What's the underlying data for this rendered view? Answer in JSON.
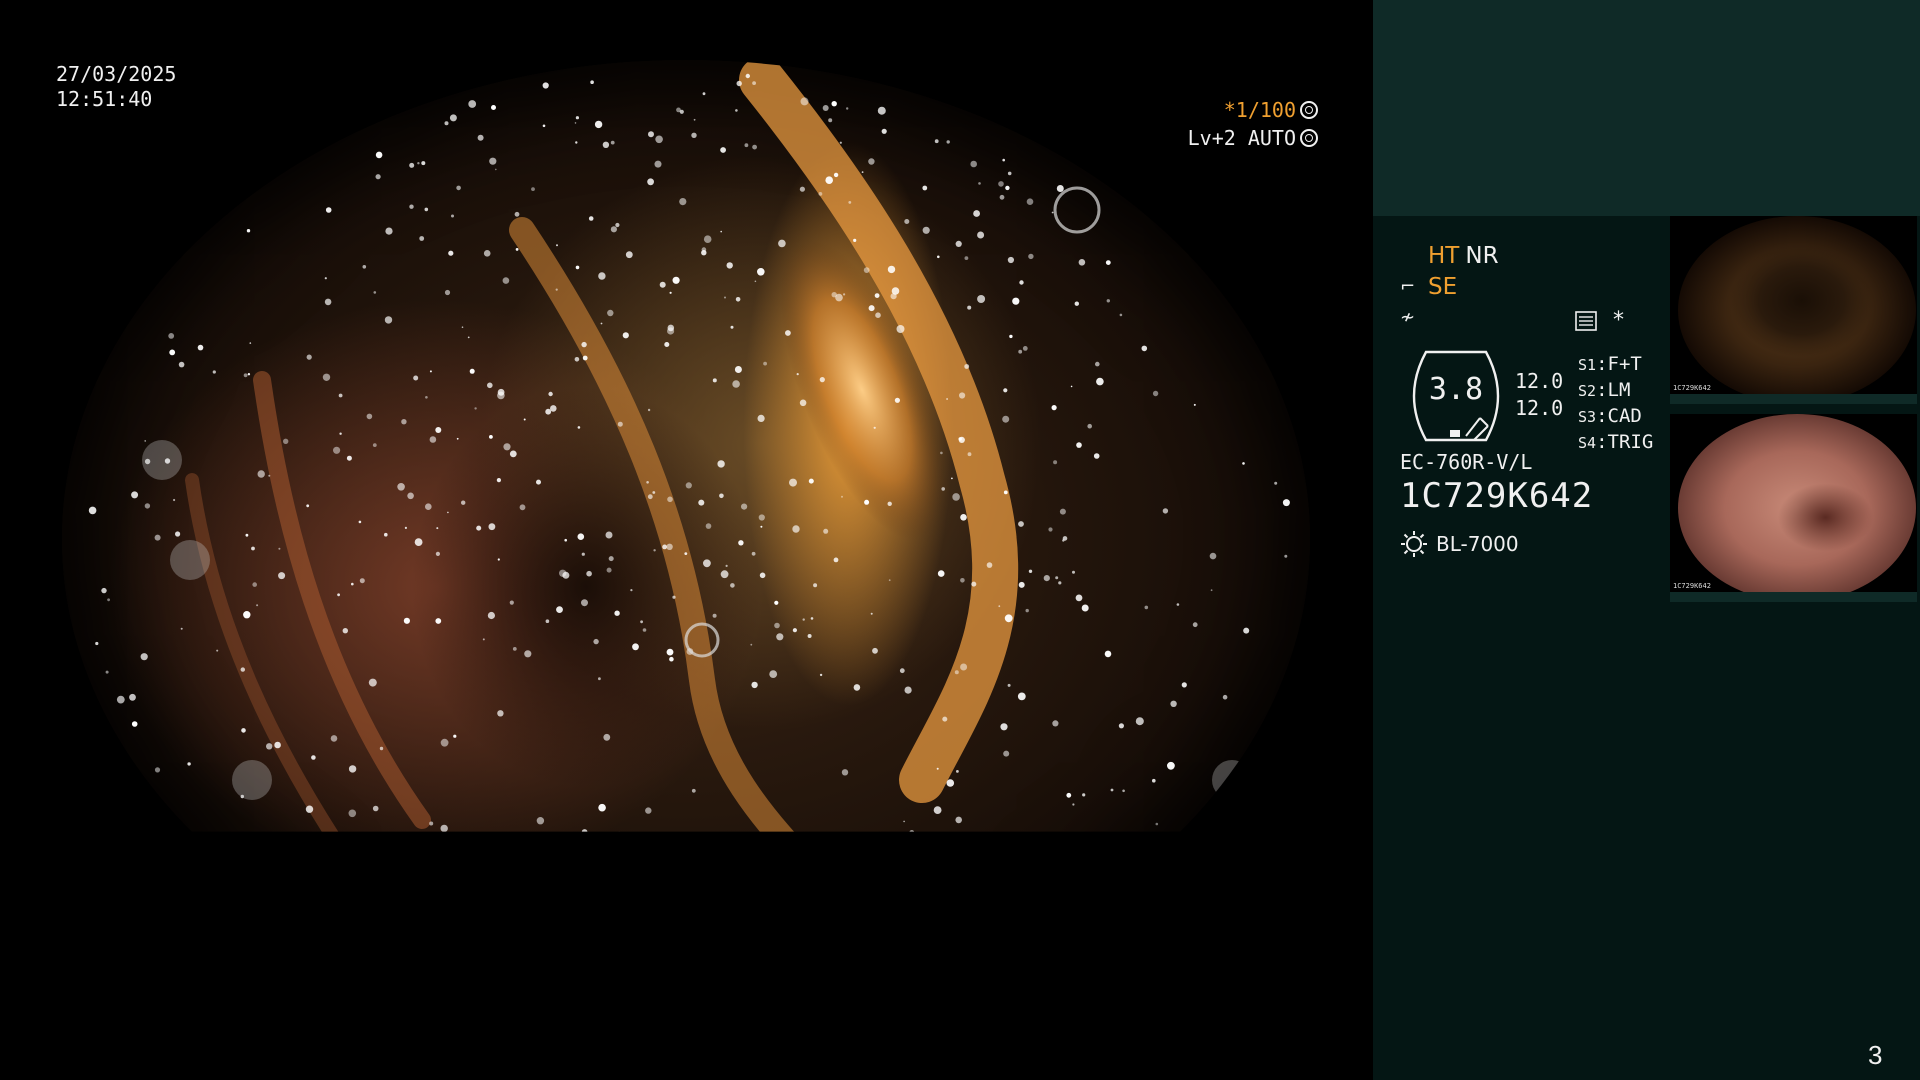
{
  "main_view": {
    "date": "27/03/2025",
    "time": "12:51:40",
    "shutter": "*1/100",
    "level": "Lv+2 AUTO"
  },
  "panel": {
    "mode_ht": "HT",
    "mode_nr": "NR",
    "mode_se": "SE",
    "settings_star": "*",
    "scope_value": "3.8",
    "scope_num_1": "12.0",
    "scope_num_2": "12.0",
    "switches": [
      {
        "key": "S1",
        "value": "F+T"
      },
      {
        "key": "S2",
        "value": "LM"
      },
      {
        "key": "S3",
        "value": "CAD"
      },
      {
        "key": "S4",
        "value": "TRIG"
      }
    ],
    "model": "EC-760R-V/L",
    "serial": "1C729K642",
    "light_source": "BL-7000"
  },
  "thumbnails": [
    {
      "label": "1C729K642",
      "kind": "brown-colon"
    },
    {
      "label": "1C729K642",
      "kind": "pink-colon"
    }
  ],
  "page_number": "3",
  "colors": {
    "accent": "#f0a030",
    "panel_bg": "#041614",
    "panel_header": "#0f2a27",
    "text": "#f0f0f0"
  }
}
